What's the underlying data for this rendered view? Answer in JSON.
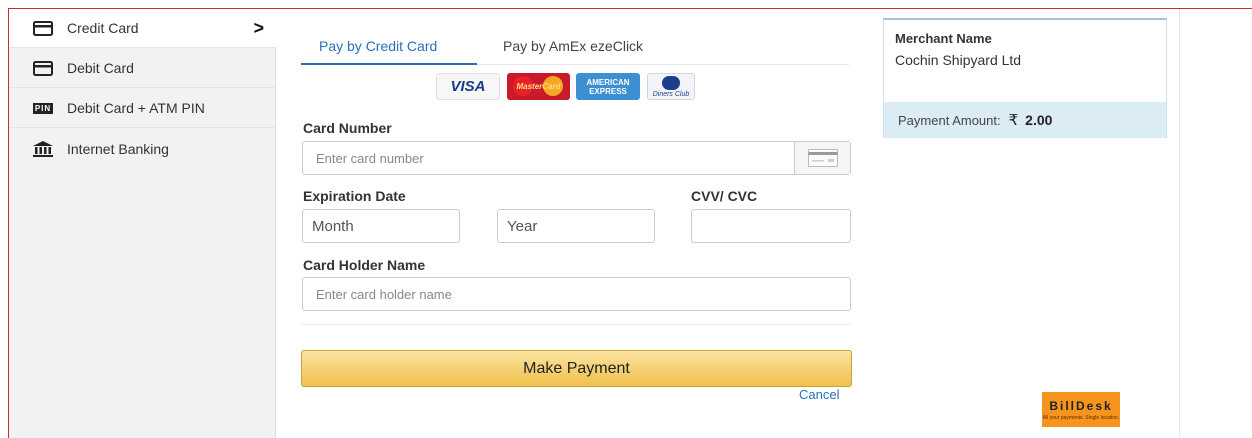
{
  "sidebar": {
    "items": [
      {
        "label": "Credit Card",
        "icon": "credit-card-icon",
        "active": true
      },
      {
        "label": "Debit Card",
        "icon": "debit-card-icon",
        "active": false
      },
      {
        "label": "Debit Card + ATM PIN",
        "icon": "pin-icon",
        "icon_text": "PIN",
        "active": false
      },
      {
        "label": "Internet Banking",
        "icon": "bank-icon",
        "active": false
      }
    ]
  },
  "tabs": [
    {
      "label": "Pay by Credit Card",
      "active": true
    },
    {
      "label": "Pay by AmEx ezeClick",
      "active": false
    }
  ],
  "card_logos": {
    "visa": "VISA",
    "mastercard": "MasterCard",
    "amex_line1": "AMERICAN",
    "amex_line2": "EXPRESS",
    "diners": "Diners Club"
  },
  "form": {
    "card_number_label": "Card Number",
    "card_number_placeholder": "Enter card number",
    "expiration_label": "Expiration Date",
    "month_placeholder": "Month",
    "year_placeholder": "Year",
    "cvv_label": "CVV/ CVC",
    "holder_label": "Card Holder Name",
    "holder_placeholder": "Enter card holder name",
    "pay_button": "Make Payment",
    "cancel": "Cancel"
  },
  "merchant": {
    "title": "Merchant Name",
    "name": "Cochin Shipyard Ltd",
    "amount_label": "Payment Amount:",
    "currency_symbol": "₹",
    "amount": "2.00"
  },
  "footer": {
    "brand": "BillDesk",
    "tagline": "All your payments. Single location."
  },
  "colors": {
    "accent_blue": "#2a6ebb",
    "button_yellow": "#f0c14b",
    "amount_bar": "#dcecf5",
    "billdesk_orange": "#f7941d",
    "frame_red": "#c9302c"
  }
}
